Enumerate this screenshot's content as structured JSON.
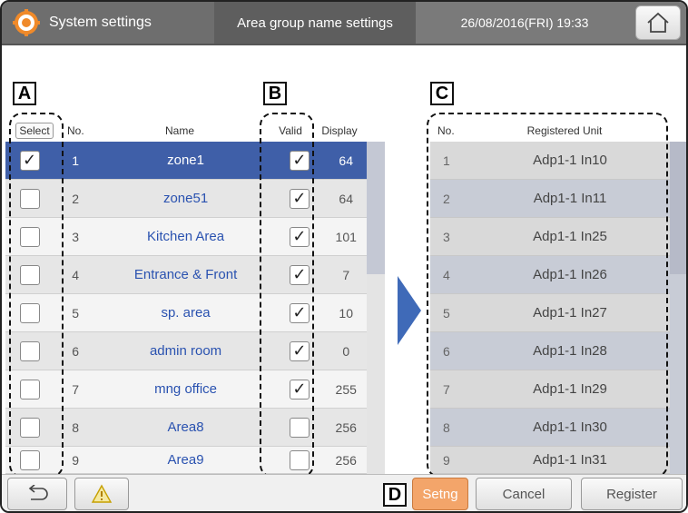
{
  "header": {
    "title": "System settings",
    "subtitle": "Area group name settings",
    "datetime": "26/08/2016(FRI) 19:33"
  },
  "labels": {
    "a": "A",
    "b": "B",
    "c": "C",
    "d": "D"
  },
  "left_table": {
    "columns": {
      "select": "Select",
      "no": "No.",
      "name": "Name",
      "valid": "Valid",
      "display": "Display"
    },
    "rows": [
      {
        "no": "1",
        "name": "zone1",
        "display": "64"
      },
      {
        "no": "2",
        "name": "zone51",
        "display": "64"
      },
      {
        "no": "3",
        "name": "Kitchen Area",
        "display": "101"
      },
      {
        "no": "4",
        "name": "Entrance & Front",
        "display": "7"
      },
      {
        "no": "5",
        "name": "sp. area",
        "display": "10"
      },
      {
        "no": "6",
        "name": "admin room",
        "display": "0"
      },
      {
        "no": "7",
        "name": "mng office",
        "display": "255"
      },
      {
        "no": "8",
        "name": "Area8",
        "display": "256"
      },
      {
        "no": "9",
        "name": "Area9",
        "display": "256"
      }
    ]
  },
  "right_table": {
    "columns": {
      "no": "No.",
      "unit": "Registered Unit"
    },
    "rows": [
      {
        "no": "1",
        "unit": "Adp1-1 In10"
      },
      {
        "no": "2",
        "unit": "Adp1-1 In11"
      },
      {
        "no": "3",
        "unit": "Adp1-1 In25"
      },
      {
        "no": "4",
        "unit": "Adp1-1 In26"
      },
      {
        "no": "5",
        "unit": "Adp1-1 In27"
      },
      {
        "no": "6",
        "unit": "Adp1-1 In28"
      },
      {
        "no": "7",
        "unit": "Adp1-1 In29"
      },
      {
        "no": "8",
        "unit": "Adp1-1 In30"
      },
      {
        "no": "9",
        "unit": "Adp1-1 In31"
      }
    ]
  },
  "footer": {
    "setng": "Setng",
    "cancel": "Cancel",
    "register": "Register"
  },
  "check_glyph": "✓"
}
